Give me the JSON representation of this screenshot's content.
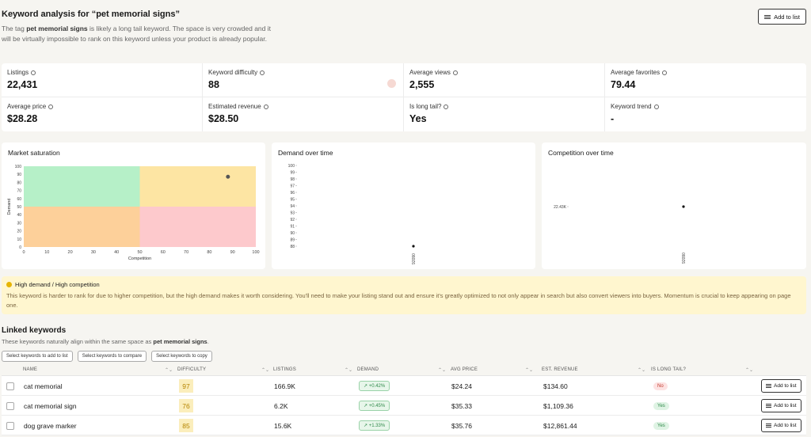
{
  "header": {
    "title": "Keyword analysis for “pet memorial signs”",
    "desc_prefix": "The tag ",
    "desc_keyword": "pet memorial signs",
    "desc_suffix": " is likely a long tail keyword. The space is very crowded and it will be virtually impossible to rank on this keyword unless your product is already popular.",
    "add_to_list": "Add to list"
  },
  "stats": [
    {
      "label": "Listings",
      "value": "22,431"
    },
    {
      "label": "Keyword difficulty",
      "value": "88"
    },
    {
      "label": "Average views",
      "value": "2,555"
    },
    {
      "label": "Average favorites",
      "value": "79.44"
    },
    {
      "label": "Average price",
      "value": "$28.28"
    },
    {
      "label": "Estimated revenue",
      "value": "$28.50"
    },
    {
      "label": "Is long tail?",
      "value": "Yes"
    },
    {
      "label": "Keyword trend",
      "value": "-"
    }
  ],
  "market_saturation": {
    "title": "Market saturation",
    "xlabel": "Competition",
    "ylabel": "Demand",
    "ticks": [
      "0",
      "10",
      "20",
      "30",
      "40",
      "50",
      "60",
      "70",
      "80",
      "90",
      "100"
    ],
    "point": {
      "x": 88,
      "y": 87
    },
    "colors": {
      "top_left": "#b6f0c8",
      "top_right": "#fde5a3",
      "bottom_left": "#fdd09a",
      "bottom_right": "#fdc9cc"
    }
  },
  "chart_data": [
    {
      "type": "scatter",
      "title": "Demand over time",
      "yticks": [
        "100",
        "99",
        "98",
        "97",
        "96",
        "95",
        "94",
        "93",
        "92",
        "91",
        "90",
        "89",
        "88"
      ],
      "x": [
        "92090"
      ],
      "values": [
        88
      ]
    },
    {
      "type": "scatter",
      "title": "Competition over time",
      "yticks": [
        "22.43K"
      ],
      "x": [
        "92090"
      ],
      "values": [
        22.43
      ]
    }
  ],
  "callout": {
    "heading": "High demand / High competition",
    "text": "This keyword is harder to rank for due to higher competition, but the high demand makes it worth considering. You'll need to make your listing stand out and ensure it's greatly optimized to not only appear in search but also convert viewers into buyers. Momentum is crucial to keep appearing on page one."
  },
  "linked": {
    "title": "Linked keywords",
    "desc_prefix": "These keywords naturally align within the same space as ",
    "desc_keyword": "pet memorial signs",
    "desc_suffix": ".",
    "btn_add": "Select keywords to add to list",
    "btn_compare": "Select keywords to compare",
    "btn_copy": "Select keywords to copy"
  },
  "table": {
    "columns": [
      "NAME",
      "DIFFICULTY",
      "LISTINGS",
      "DEMAND",
      "AVG PRICE",
      "EST. REVENUE",
      "IS LONG TAIL?"
    ],
    "rows": [
      {
        "name": "cat memorial",
        "difficulty": "97",
        "listings": "166.9K",
        "demand": "+0.42%",
        "avg_price": "$24.24",
        "revenue": "$134.60",
        "long_tail": "No"
      },
      {
        "name": "cat memorial sign",
        "difficulty": "76",
        "listings": "6.2K",
        "demand": "+0.45%",
        "avg_price": "$35.33",
        "revenue": "$1,109.36",
        "long_tail": "Yes"
      },
      {
        "name": "dog grave marker",
        "difficulty": "85",
        "listings": "15.6K",
        "demand": "+1.33%",
        "avg_price": "$35.76",
        "revenue": "$12,861.44",
        "long_tail": "Yes"
      }
    ],
    "row_add": "Add to list"
  }
}
